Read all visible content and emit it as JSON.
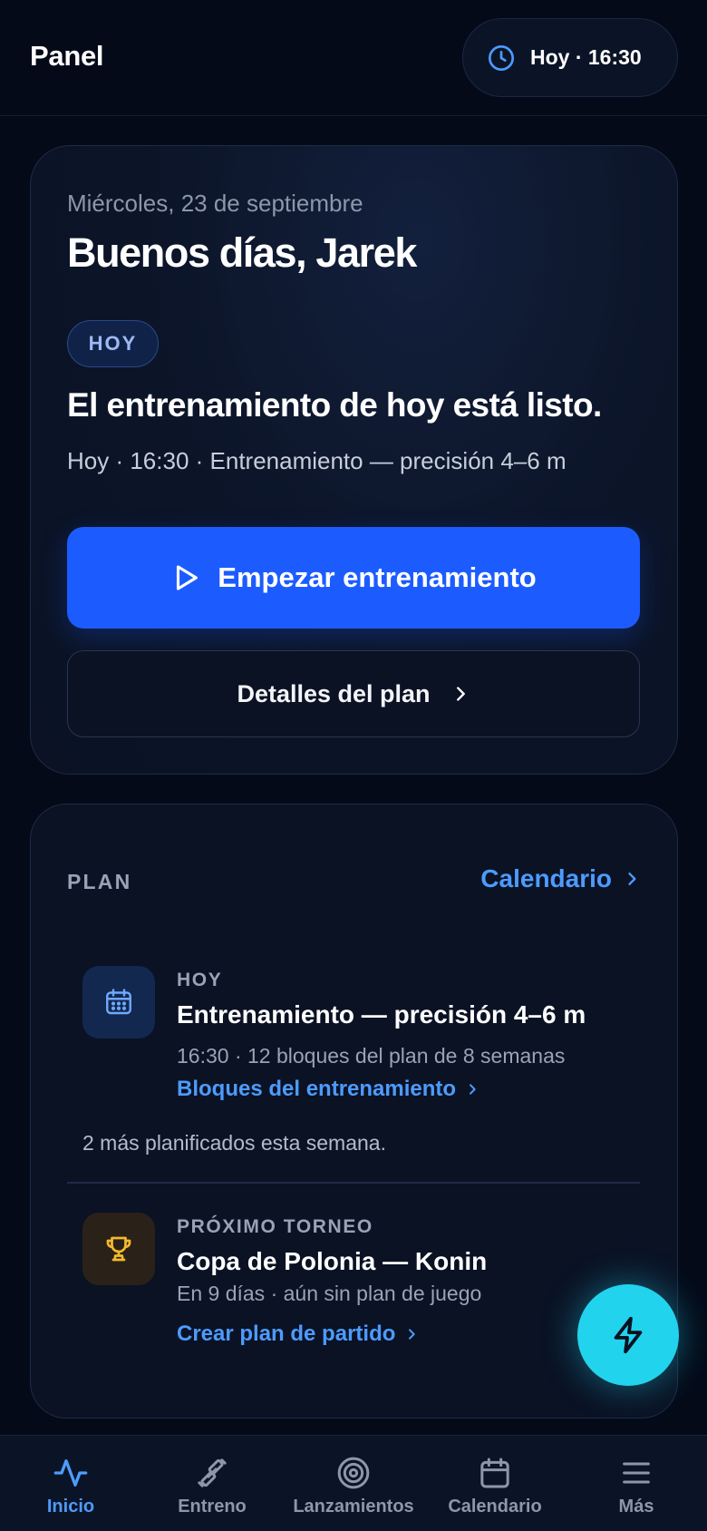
{
  "header": {
    "title": "Panel",
    "time_pill": "Hoy · 16:30",
    "time_icon": "clock-icon"
  },
  "hero": {
    "date": "Miércoles, 23 de septiembre",
    "greeting": "Buenos días, Jarek",
    "badge": "HOY",
    "headline": "El entrenamiento de hoy está listo.",
    "subtitle": "Hoy · 16:30 · Entrenamiento — precisión 4–6 m",
    "primary_button": "Empezar entrenamiento",
    "secondary_button": "Detalles del plan"
  },
  "plan": {
    "section_label": "PLAN",
    "calendar_link": "Calendario",
    "today": {
      "kicker": "HOY",
      "title": "Entrenamiento — precisión 4–6 m",
      "meta": "16:30 · 12 bloques del plan de 8 semanas",
      "link": "Bloques del entrenamiento",
      "icon": "calendar-icon"
    },
    "note": "2 más planificados esta semana.",
    "tournament": {
      "kicker": "PRÓXIMO TORNEO",
      "title": "Copa de Polonia — Konin",
      "meta": "En 9 días · aún sin plan de juego",
      "link": "Crear plan de partido",
      "icon": "trophy-icon"
    }
  },
  "fab": {
    "icon": "lightning-icon"
  },
  "nav": {
    "items": [
      {
        "label": "Inicio",
        "icon": "activity-icon",
        "active": true
      },
      {
        "label": "Entreno",
        "icon": "dumbbell-icon",
        "active": false
      },
      {
        "label": "Lanzamientos",
        "icon": "target-icon",
        "active": false
      },
      {
        "label": "Calendario",
        "icon": "calendar-icon",
        "active": false
      },
      {
        "label": "Más",
        "icon": "menu-icon",
        "active": false
      }
    ]
  },
  "colors": {
    "background": "#040a18",
    "accent": "#1c5cff",
    "link": "#4d9bff",
    "fab": "#22d3ee",
    "trophy": "#f5b82e"
  }
}
